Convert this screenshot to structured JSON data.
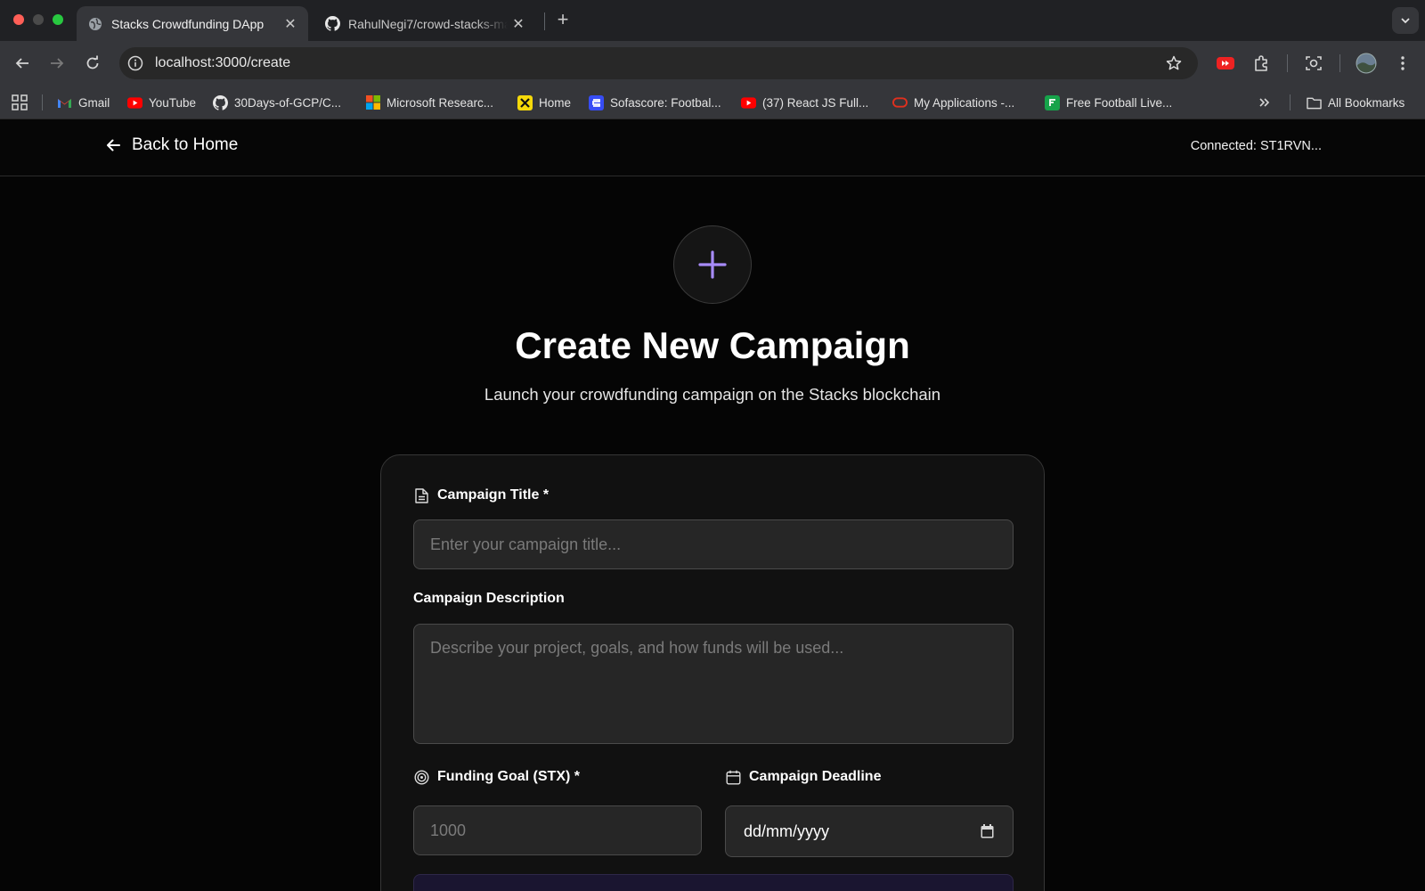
{
  "browser": {
    "tabs": [
      {
        "title": "Stacks Crowdfunding DApp",
        "icon": "globe-icon",
        "active": true
      },
      {
        "title": "RahulNegi7/crowd-stacks-main",
        "icon": "github-icon",
        "active": false
      }
    ],
    "url": "localhost:3000/create",
    "bookmarks": [
      {
        "label": "Gmail",
        "icon": "gmail-icon"
      },
      {
        "label": "YouTube",
        "icon": "youtube-icon"
      },
      {
        "label": "30Days-of-GCP/C...",
        "icon": "github-icon"
      },
      {
        "label": "Microsoft Researc...",
        "icon": "microsoft-icon"
      },
      {
        "label": "Home",
        "icon": "home-site-icon"
      },
      {
        "label": "Sofascore: Footbal...",
        "icon": "sofascore-icon"
      },
      {
        "label": "(37) React JS Full...",
        "icon": "youtube-icon"
      },
      {
        "label": "My Applications -...",
        "icon": "oracle-icon"
      },
      {
        "label": "Free Football Live...",
        "icon": "football-icon"
      }
    ],
    "all_bookmarks_label": "All Bookmarks"
  },
  "header": {
    "back_label": "Back to Home",
    "connected_label": "Connected: ST1RVN..."
  },
  "hero": {
    "title": "Create New Campaign",
    "subtitle": "Launch your crowdfunding campaign on the Stacks blockchain"
  },
  "form": {
    "title_label": "Campaign Title *",
    "title_placeholder": "Enter your campaign title...",
    "description_label": "Campaign Description",
    "description_placeholder": "Describe your project, goals, and how funds will be used...",
    "goal_label": "Funding Goal (STX) *",
    "goal_placeholder": "1000",
    "deadline_label": "Campaign Deadline",
    "deadline_value": "dd/mm/yyyy"
  },
  "colors": {
    "accent": "#a78bfa",
    "background": "#050505",
    "card": "#111111"
  }
}
